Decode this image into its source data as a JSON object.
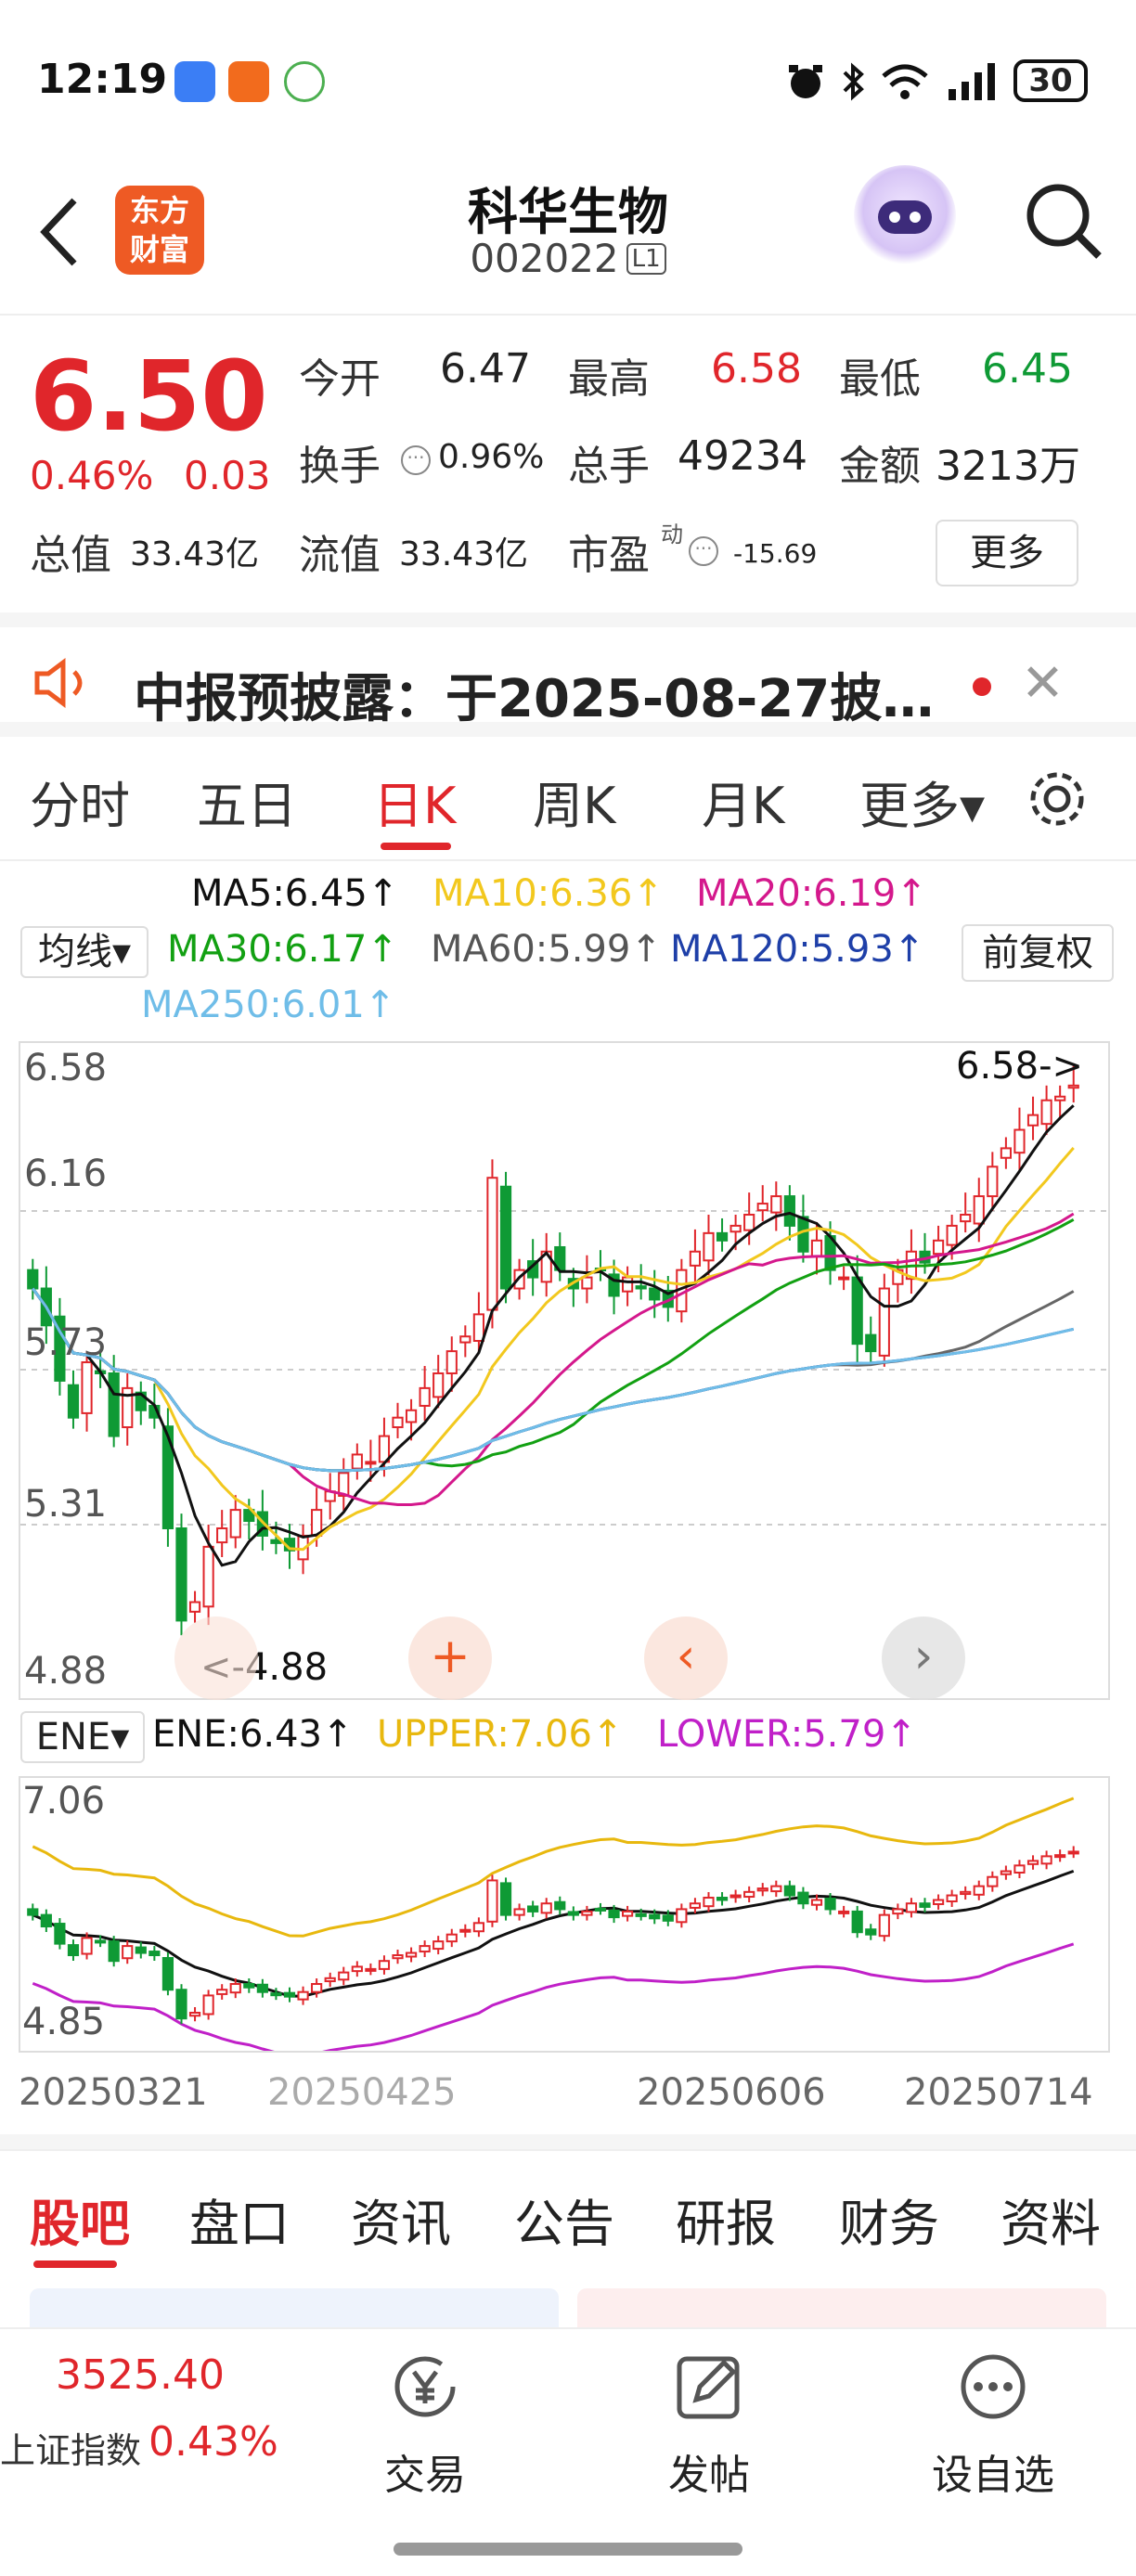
{
  "status_bar": {
    "time": "12:19",
    "battery": "30"
  },
  "header": {
    "logo_line1": "东方",
    "logo_line2": "财富",
    "stock_name": "科华生物",
    "stock_code": "002022",
    "level_badge": "L1"
  },
  "quote": {
    "price": "6.50",
    "change_pct": "0.46%",
    "change_amt": "0.03",
    "open_label": "今开",
    "open": "6.47",
    "high_label": "最高",
    "high": "6.58",
    "low_label": "最低",
    "low": "6.45",
    "turnover_label": "换手",
    "turnover": "0.96%",
    "volume_label": "总手",
    "volume": "49234",
    "amount_label": "金额",
    "amount": "3213万",
    "mktcap_label": "总值",
    "mktcap": "33.43亿",
    "float_label": "流值",
    "float_cap": "33.43亿",
    "pe_label": "市盈",
    "pe_sup": "动",
    "pe": "-15.69",
    "more": "更多"
  },
  "notice": {
    "text": "中报预披露：于2025-08-27披…"
  },
  "period_tabs": [
    "分时",
    "五日",
    "日K",
    "周K",
    "月K",
    "更多▾"
  ],
  "active_tab": "日K",
  "ma_legend": {
    "ma5": "MA5:6.45↑",
    "ma10": "MA10:6.36↑",
    "ma20": "MA20:6.19↑",
    "ma30": "MA30:6.17↑",
    "ma60": "MA60:5.99↑",
    "ma120": "MA120:5.93↑",
    "ma250": "MA250:6.01↑",
    "ma_select": "均线▾",
    "adjust": "前复权"
  },
  "colors": {
    "ma5": "#111111",
    "ma10": "#f2c81e",
    "ma20": "#d4188c",
    "ma30": "#12a012",
    "ma60": "#666666",
    "ma120": "#1e3fa8",
    "ma250": "#6fbde8",
    "up": "#e0262b",
    "down": "#0f9a35"
  },
  "kline": {
    "y_labels": [
      "6.58",
      "6.16",
      "5.73",
      "5.31",
      "4.88"
    ],
    "max_label": "6.58->",
    "min_label": "<-4.88"
  },
  "ene": {
    "select": "ENE▾",
    "ene": "ENE:6.43↑",
    "upper": "UPPER:7.06↑",
    "lower": "LOWER:5.79↑",
    "y_labels": [
      "7.06",
      "4.85"
    ]
  },
  "dates": [
    "20250321",
    "20250425",
    "20250606",
    "20250714"
  ],
  "sub_tabs": [
    "股吧",
    "盘口",
    "资讯",
    "公告",
    "研报",
    "财务",
    "资料"
  ],
  "bottom_nav": {
    "index_value": "3525.40",
    "index_name": "上证指数",
    "index_pct": "0.43%",
    "trade": "交易",
    "post": "发帖",
    "watch": "设自选"
  },
  "chart_data": {
    "type": "candlestick",
    "title": "",
    "ylim": [
      4.88,
      6.58
    ],
    "x_ticks": [
      "20250321",
      "20250425",
      "20250606",
      "20250714"
    ],
    "period_high": 6.58,
    "period_low": 4.88,
    "closes_approx": [
      5.95,
      5.85,
      5.7,
      5.6,
      5.75,
      5.72,
      5.55,
      5.68,
      5.62,
      5.6,
      5.3,
      5.05,
      5.1,
      5.25,
      5.3,
      5.35,
      5.32,
      5.28,
      5.26,
      5.24,
      5.28,
      5.35,
      5.4,
      5.45,
      5.5,
      5.48,
      5.55,
      5.6,
      5.62,
      5.68,
      5.72,
      5.78,
      5.82,
      5.88,
      6.25,
      5.95,
      6.0,
      5.98,
      6.05,
      6.0,
      5.95,
      5.98,
      6.0,
      5.93,
      5.98,
      5.95,
      5.92,
      5.9,
      6.0,
      6.05,
      6.1,
      6.08,
      6.12,
      6.15,
      6.18,
      6.2,
      6.12,
      6.05,
      6.08,
      6.0,
      5.98,
      5.8,
      5.78,
      5.95,
      6.0,
      6.05,
      6.02,
      6.08,
      6.12,
      6.15,
      6.2,
      6.28,
      6.33,
      6.38,
      6.42,
      6.46,
      6.47,
      6.5
    ]
  }
}
